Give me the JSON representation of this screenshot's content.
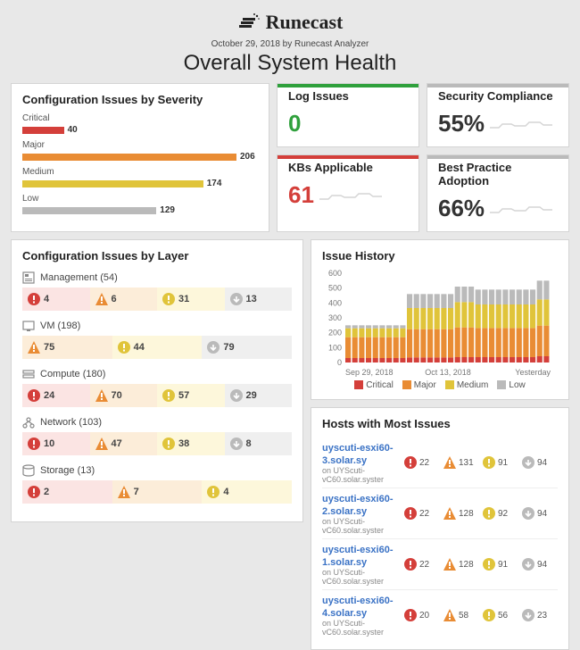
{
  "header": {
    "brand": "Runecast",
    "byline": "October 29, 2018 by Runecast Analyzer",
    "title": "Overall System Health"
  },
  "severity": {
    "title": "Configuration Issues by Severity",
    "max": 206,
    "items": [
      {
        "label": "Critical",
        "value": 40,
        "color": "#d43f3a"
      },
      {
        "label": "Major",
        "value": 206,
        "color": "#e98c34"
      },
      {
        "label": "Medium",
        "value": 174,
        "color": "#e0c43a"
      },
      {
        "label": "Low",
        "value": 129,
        "color": "#bababa"
      }
    ]
  },
  "metrics": {
    "log_issues": {
      "title": "Log Issues",
      "value": "0",
      "color": "#2fa03c",
      "topbar": "#2fa03c"
    },
    "security": {
      "title": "Security Compliance",
      "value": "55%",
      "color": "#333",
      "topbar": "#bababa"
    },
    "kbs": {
      "title": "KBs Applicable",
      "value": "61",
      "color": "#d43f3a",
      "topbar": "#d43f3a"
    },
    "best_practice": {
      "title": "Best Practice Adoption",
      "value": "66%",
      "color": "#333",
      "topbar": "#bababa"
    }
  },
  "layers": {
    "title": "Configuration Issues by Layer",
    "groups": [
      {
        "icon": "management",
        "label": "Management (54)",
        "cells": [
          {
            "t": "crit",
            "v": 4
          },
          {
            "t": "maj",
            "v": 6
          },
          {
            "t": "med",
            "v": 31
          },
          {
            "t": "low",
            "v": 13
          }
        ]
      },
      {
        "icon": "vm",
        "label": "VM (198)",
        "cells": [
          {
            "t": "maj",
            "v": 75
          },
          {
            "t": "med",
            "v": 44
          },
          {
            "t": "low",
            "v": 79
          }
        ]
      },
      {
        "icon": "compute",
        "label": "Compute (180)",
        "cells": [
          {
            "t": "crit",
            "v": 24
          },
          {
            "t": "maj",
            "v": 70
          },
          {
            "t": "med",
            "v": 57
          },
          {
            "t": "low",
            "v": 29
          }
        ]
      },
      {
        "icon": "network",
        "label": "Network (103)",
        "cells": [
          {
            "t": "crit",
            "v": 10
          },
          {
            "t": "maj",
            "v": 47
          },
          {
            "t": "med",
            "v": 38
          },
          {
            "t": "low",
            "v": 8
          }
        ]
      },
      {
        "icon": "storage",
        "label": "Storage (13)",
        "cells": [
          {
            "t": "crit",
            "v": 2
          },
          {
            "t": "maj",
            "v": 7
          },
          {
            "t": "med",
            "v": 4
          }
        ]
      }
    ]
  },
  "history": {
    "title": "Issue History",
    "x_labels": [
      "Sep 29, 2018",
      "Oct 13, 2018",
      "Yesterday"
    ],
    "y_max": 600,
    "y_ticks": [
      0,
      100,
      200,
      300,
      400,
      500,
      600
    ],
    "legend": [
      "Critical",
      "Major",
      "Medium",
      "Low"
    ],
    "chart_data": {
      "type": "bar",
      "stacked": true,
      "categories_note": "daily, 30 bars from Sep 29, 2018 to Oct 28, 2018 (Yesterday)",
      "series": [
        {
          "name": "Critical",
          "color": "#d43f3a",
          "values": [
            30,
            30,
            30,
            30,
            30,
            30,
            30,
            30,
            30,
            34,
            34,
            34,
            34,
            34,
            34,
            34,
            36,
            36,
            36,
            36,
            36,
            36,
            36,
            36,
            36,
            36,
            36,
            36,
            42,
            42
          ]
        },
        {
          "name": "Major",
          "color": "#e98c34",
          "values": [
            140,
            140,
            140,
            140,
            140,
            140,
            140,
            140,
            140,
            190,
            190,
            190,
            190,
            190,
            190,
            190,
            200,
            200,
            200,
            196,
            196,
            196,
            196,
            196,
            196,
            196,
            196,
            196,
            206,
            206
          ]
        },
        {
          "name": "Medium",
          "color": "#e0c43a",
          "values": [
            60,
            60,
            60,
            60,
            60,
            60,
            60,
            60,
            60,
            142,
            142,
            142,
            142,
            142,
            142,
            142,
            170,
            170,
            170,
            158,
            158,
            158,
            158,
            158,
            158,
            158,
            158,
            158,
            176,
            176
          ]
        },
        {
          "name": "Low",
          "color": "#bababa",
          "values": [
            20,
            20,
            20,
            20,
            20,
            20,
            20,
            20,
            20,
            94,
            94,
            94,
            94,
            94,
            94,
            94,
            104,
            104,
            104,
            100,
            100,
            100,
            100,
            100,
            100,
            100,
            100,
            100,
            126,
            126
          ]
        }
      ]
    }
  },
  "hosts": {
    "title": "Hosts with Most Issues",
    "rows": [
      {
        "name": "uyscuti-esxi60-3.solar.sy",
        "sub": "on UYScuti-vC60.solar.syster",
        "crit": 22,
        "maj": 131,
        "med": 91,
        "low": 94
      },
      {
        "name": "uyscuti-esxi60-2.solar.sy",
        "sub": "on UYScuti-vC60.solar.syster",
        "crit": 22,
        "maj": 128,
        "med": 92,
        "low": 94
      },
      {
        "name": "uyscuti-esxi60-1.solar.sy",
        "sub": "on UYScuti-vC60.solar.syster",
        "crit": 22,
        "maj": 128,
        "med": 91,
        "low": 94
      },
      {
        "name": "uyscuti-esxi60-4.solar.sy",
        "sub": "on UYScuti-vC60.solar.syster",
        "crit": 20,
        "maj": 58,
        "med": 56,
        "low": 23
      }
    ]
  }
}
